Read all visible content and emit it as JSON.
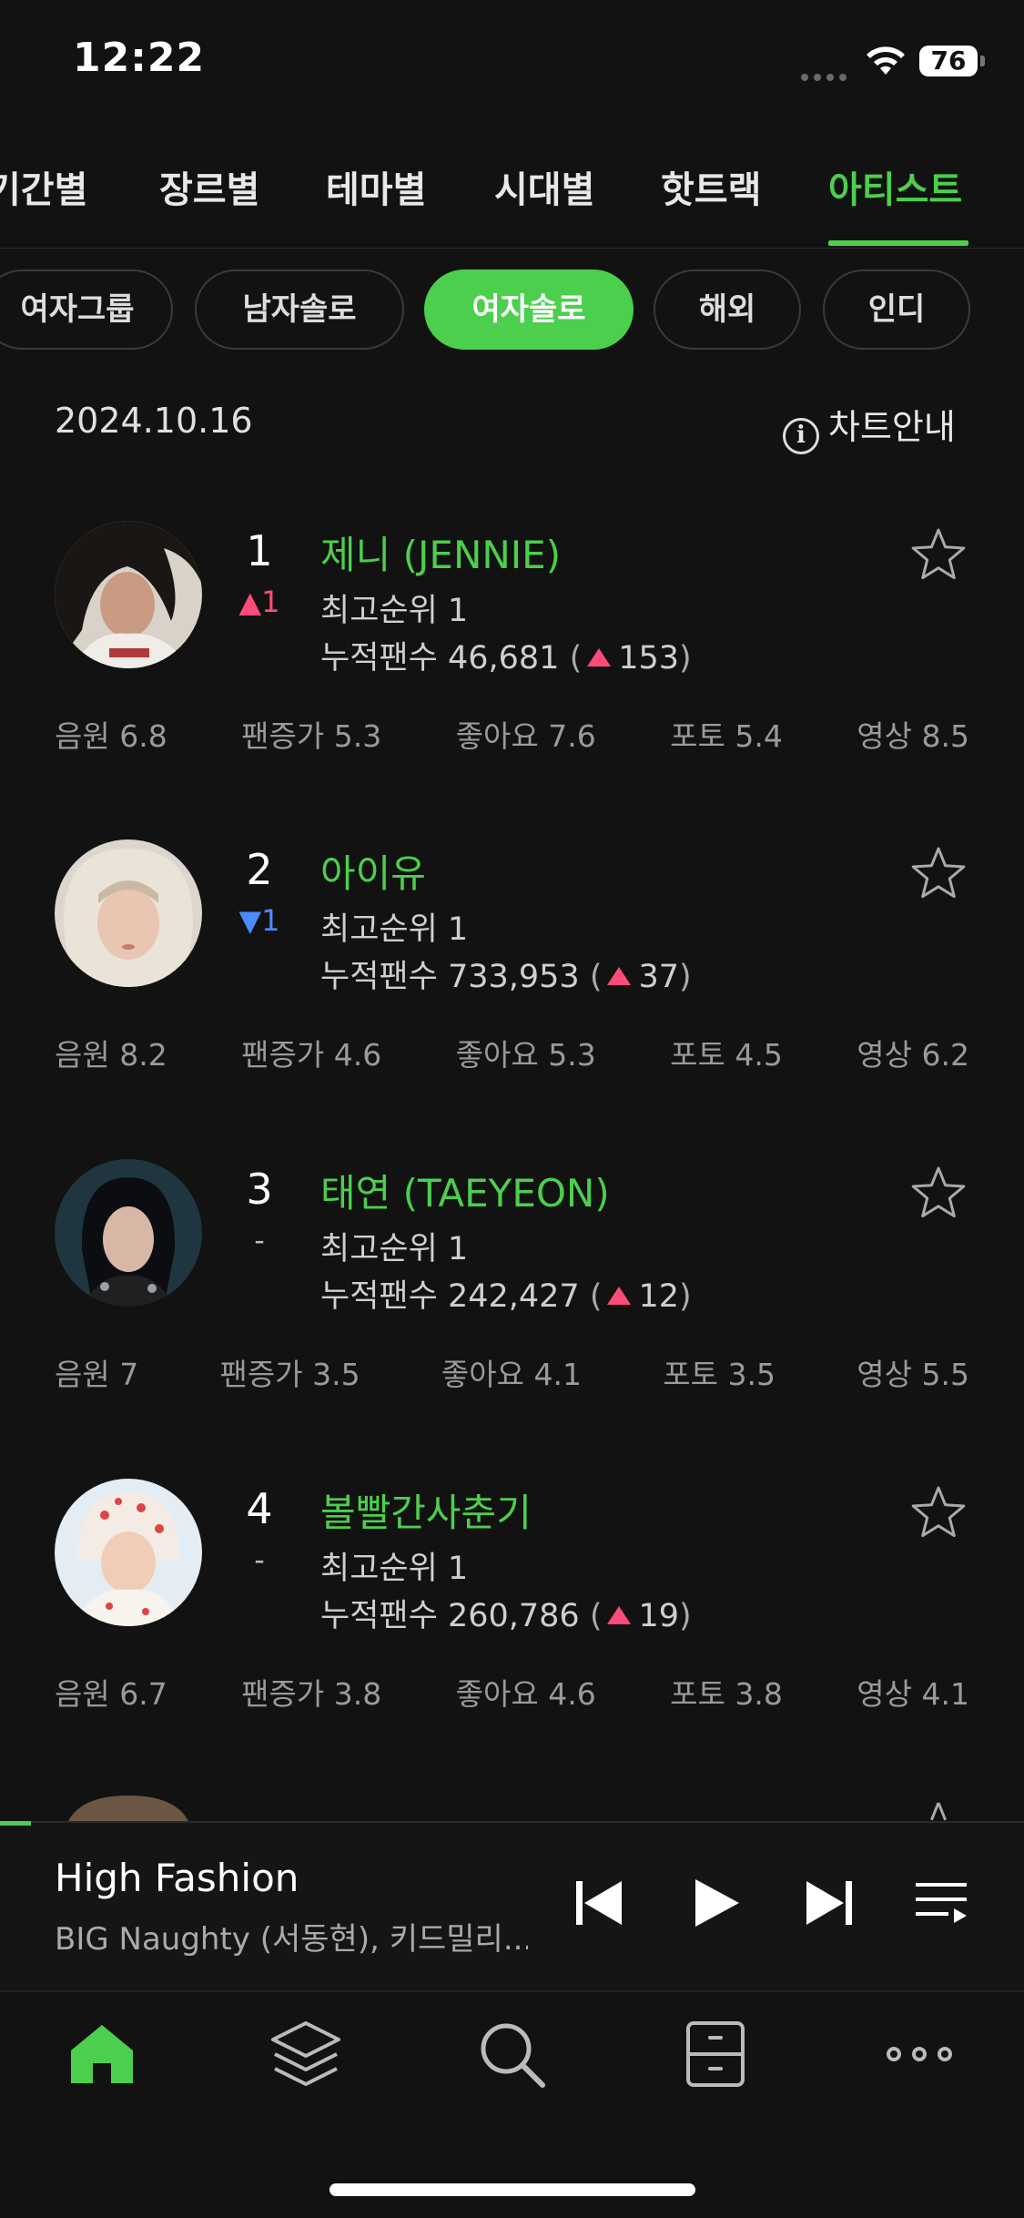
{
  "status": {
    "time": "12:22",
    "battery": "76"
  },
  "tabs": [
    {
      "label": "기간별"
    },
    {
      "label": "장르별"
    },
    {
      "label": "테마별"
    },
    {
      "label": "시대별"
    },
    {
      "label": "핫트랙"
    },
    {
      "label": "아티스트",
      "active": true
    }
  ],
  "filters": [
    {
      "label": "여자그룹"
    },
    {
      "label": "남자솔로"
    },
    {
      "label": "여자솔로",
      "active": true
    },
    {
      "label": "해외"
    },
    {
      "label": "인디"
    }
  ],
  "chart": {
    "date": "2024.10.16",
    "guide_label": "차트안내"
  },
  "artists": [
    {
      "rank": "1",
      "change": "1",
      "change_dir": "up",
      "name": "제니 (JENNIE)",
      "peak": "최고순위 1",
      "fans_label": "누적팬수",
      "fans": "46,681",
      "fans_delta": "153",
      "stats": [
        "음원 6.8",
        "팬증가 5.3",
        "좋아요 7.6",
        "포토 5.4",
        "영상 8.5"
      ]
    },
    {
      "rank": "2",
      "change": "1",
      "change_dir": "down",
      "name": "아이유",
      "peak": "최고순위 1",
      "fans_label": "누적팬수",
      "fans": "733,953",
      "fans_delta": "37",
      "stats": [
        "음원 8.2",
        "팬증가 4.6",
        "좋아요 5.3",
        "포토 4.5",
        "영상 6.2"
      ]
    },
    {
      "rank": "3",
      "change": "-",
      "change_dir": "same",
      "name": "태연 (TAEYEON)",
      "peak": "최고순위 1",
      "fans_label": "누적팬수",
      "fans": "242,427",
      "fans_delta": "12",
      "stats": [
        "음원 7",
        "팬증가 3.5",
        "좋아요 4.1",
        "포토 3.5",
        "영상 5.5"
      ]
    },
    {
      "rank": "4",
      "change": "-",
      "change_dir": "same",
      "name": "볼빨간사춘기",
      "peak": "최고순위 1",
      "fans_label": "누적팬수",
      "fans": "260,786",
      "fans_delta": "19",
      "stats": [
        "음원 6.7",
        "팬증가 3.8",
        "좋아요 4.6",
        "포토 3.8",
        "영상 4.1"
      ]
    }
  ],
  "player": {
    "title": "High Fashion",
    "artist": "BIG Naughty (서동현), 키드밀리...",
    "progress": 0.03
  },
  "icons": {
    "nav": [
      "home-icon",
      "layers-icon",
      "search-icon",
      "locker-icon",
      "more-icon"
    ],
    "player": [
      "previous-icon",
      "play-icon",
      "next-icon",
      "playlist-icon"
    ]
  },
  "colors": {
    "accent": "#4ccf4c",
    "up": "#ff4b7a",
    "down": "#4a8cff",
    "background": "#121212"
  }
}
